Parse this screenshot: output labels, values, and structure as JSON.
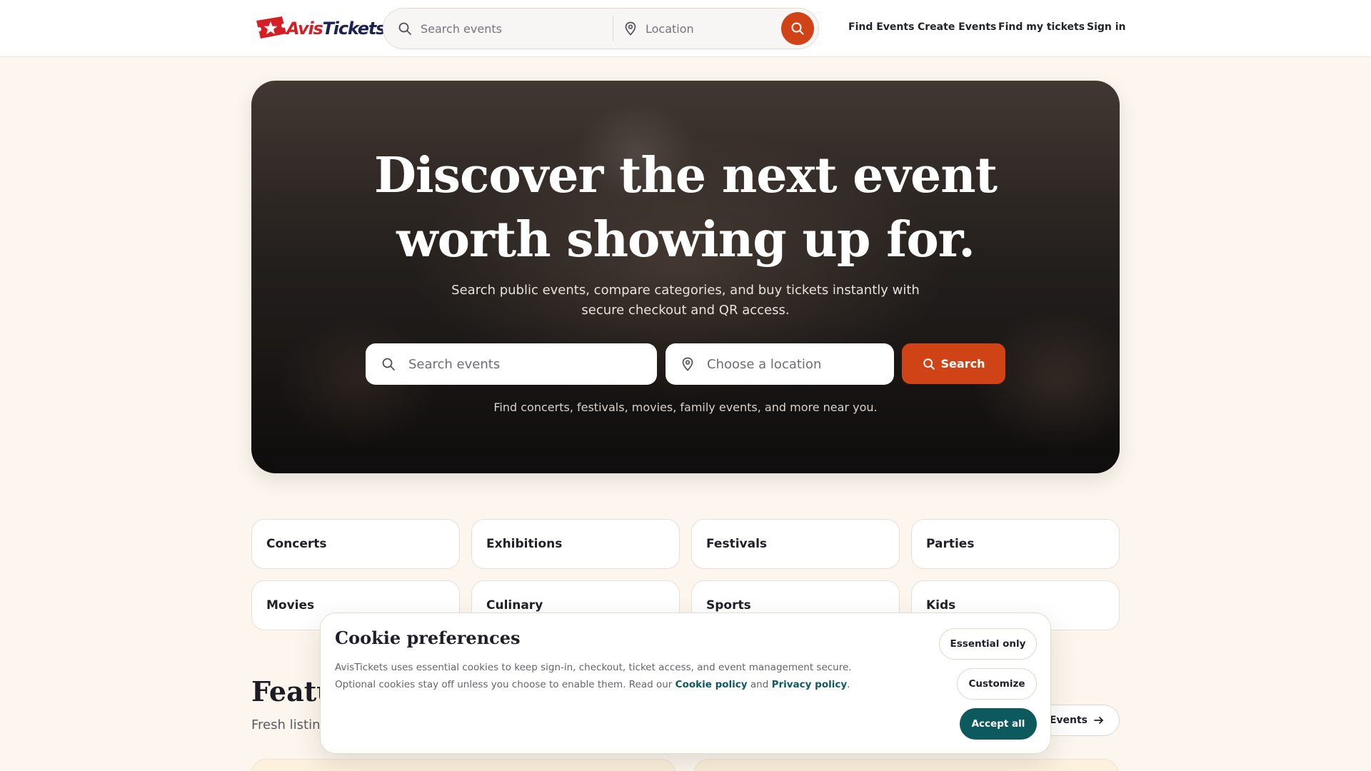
{
  "header": {
    "logo": {
      "part1": "Avis",
      "part2": "Tickets"
    },
    "search": {
      "placeholder": "Search events",
      "location_placeholder": "Location"
    },
    "nav": [
      "Find Events",
      "Create Events",
      "Find my tickets",
      "Sign in"
    ]
  },
  "hero": {
    "title_line1": "Discover the next event",
    "title_line2": "worth showing up for.",
    "subtitle_line1": "Search public events, compare categories, and buy tickets instantly with",
    "subtitle_line2": "secure checkout and QR access.",
    "search_placeholder": "Search events",
    "location_placeholder": "Choose a location",
    "search_button": "Search",
    "note": "Find concerts, festivals, movies, family events, and more near you."
  },
  "categories": [
    "Concerts",
    "Exhibitions",
    "Festivals",
    "Parties",
    "Movies",
    "Culinary",
    "Sports",
    "Kids"
  ],
  "featured": {
    "title": "Featured Events",
    "subtitle": "Fresh listings",
    "all_button": "All Events"
  },
  "cookie": {
    "title": "Cookie preferences",
    "text_line1": "AvisTickets uses essential cookies to keep sign-in, checkout, ticket access, and event management secure.",
    "text_line2_a": "Optional cookies stay off unless you choose to enable them. Read our ",
    "cookie_policy": "Cookie policy",
    "and": " and ",
    "privacy_policy": "Privacy policy",
    "period": ".",
    "essential_button": "Essential only",
    "customize_button": "Customize",
    "accept_button": "Accept all"
  },
  "colors": {
    "accent": "#cf4316",
    "teal": "#0d5a5e",
    "brand_red": "#d41f27",
    "brand_navy": "#1d2254",
    "page_bg": "#fcf6ee"
  },
  "icons": [
    "logo-star-icon",
    "search-icon",
    "location-pin-icon",
    "arrow-right-icon"
  ]
}
